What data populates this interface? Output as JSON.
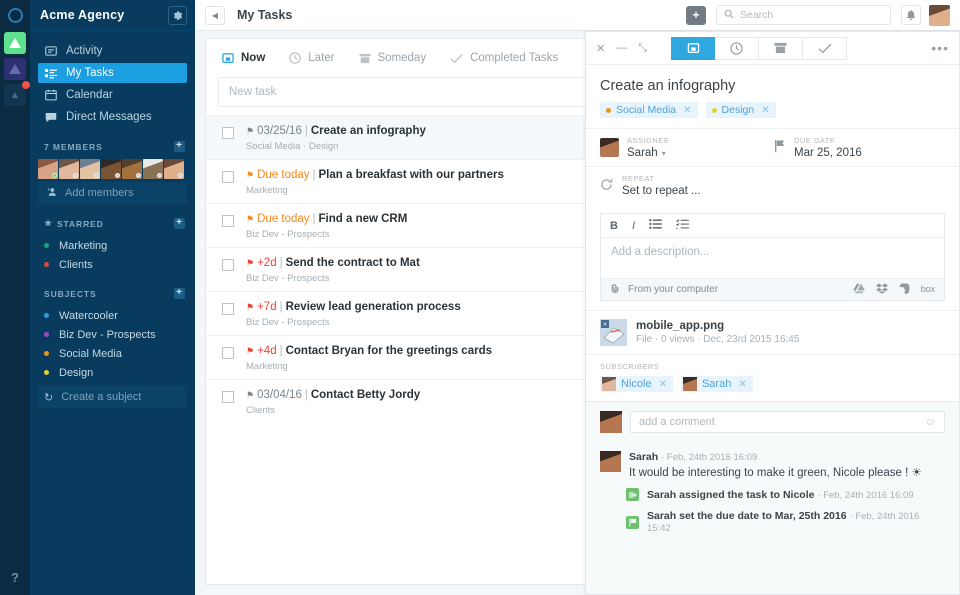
{
  "rail": {
    "logo_icon": "circle-logo-icon",
    "items": [
      {
        "name": "workspace-green",
        "icon": "triangle-icon",
        "badge": false
      },
      {
        "name": "workspace-purple",
        "icon": "triangle-icon",
        "badge": false
      },
      {
        "name": "workspace-more",
        "icon": "triangles-icon",
        "badge": true
      }
    ],
    "help_label": "?"
  },
  "sidebar": {
    "title": "Acme Agency",
    "gear_icon": "gear-icon",
    "nav": [
      {
        "label": "Activity",
        "icon": "activity-icon",
        "active": false
      },
      {
        "label": "My Tasks",
        "icon": "tasks-icon",
        "active": true
      },
      {
        "label": "Calendar",
        "icon": "calendar-icon",
        "active": false
      },
      {
        "label": "Direct Messages",
        "icon": "message-icon",
        "active": false
      }
    ],
    "members": {
      "header": "7 MEMBERS",
      "add_label": "Add members",
      "add_icon": "add-person-icon",
      "avatars": [
        {
          "name": "member-1",
          "c1": "#8a5a44",
          "c2": "#d8a384",
          "presence": "#6dd36d"
        },
        {
          "name": "member-2",
          "c1": "#6d5547",
          "c2": "#e2b89c",
          "presence": "#c9cfd3"
        },
        {
          "name": "member-3",
          "c1": "#6f7f92",
          "c2": "#e3c3a4",
          "presence": "#c9cfd3"
        },
        {
          "name": "member-4",
          "c1": "#2e2a28",
          "c2": "#7b5436",
          "presence": "#c9cfd3"
        },
        {
          "name": "member-5",
          "c1": "#52402f",
          "c2": "#a3713f",
          "presence": "#c9cfd3"
        },
        {
          "name": "member-6",
          "c1": "#e9e9e9",
          "c2": "#8a7256",
          "presence": "#c9cfd3"
        },
        {
          "name": "member-7",
          "c1": "#6b4a38",
          "c2": "#e0b08c",
          "presence": "#c9cfd3"
        }
      ]
    },
    "starred": {
      "header": "STARRED",
      "items": [
        {
          "label": "Marketing",
          "color": "#18a47c"
        },
        {
          "label": "Clients",
          "color": "#e0473c"
        }
      ]
    },
    "subjects": {
      "header": "SUBJECTS",
      "items": [
        {
          "label": "Watercooler",
          "color": "#2b9fe3"
        },
        {
          "label": "Biz Dev - Prospects",
          "color": "#a546c9"
        },
        {
          "label": "Social Media",
          "color": "#e89519"
        },
        {
          "label": "Design",
          "color": "#e2d12f"
        }
      ],
      "create_label": "Create a subject",
      "create_icon": "refresh-icon"
    }
  },
  "topbar": {
    "back_icon": "chevron-left-icon",
    "title": "My Tasks",
    "plus_icon": "plus-icon",
    "search": {
      "placeholder": "Search",
      "icon": "search-icon",
      "value": ""
    },
    "bell_icon": "bell-icon",
    "avatar": {
      "name": "current-user-avatar",
      "c1": "#6b4a38",
      "c2": "#e0b08c"
    }
  },
  "tasklist": {
    "tabs": [
      {
        "label": "Now",
        "icon": "inbox-icon",
        "active": true
      },
      {
        "label": "Later",
        "icon": "clock-icon",
        "active": false
      },
      {
        "label": "Someday",
        "icon": "archive-icon",
        "active": false
      },
      {
        "label": "Completed Tasks",
        "icon": "check-icon",
        "active": false
      }
    ],
    "new_task_placeholder": "New task",
    "rows": [
      {
        "due": "03/25/16",
        "due_style": "gray",
        "title": "Create an infography",
        "subject": "Social Media · Design",
        "selected": true
      },
      {
        "due": "Due today",
        "due_style": "orange",
        "title": "Plan a breakfast with our partners",
        "subject": "Marketing",
        "selected": false
      },
      {
        "due": "Due today",
        "due_style": "orange",
        "title": "Find a new CRM",
        "subject": "Biz Dev - Prospects",
        "selected": false
      },
      {
        "due": "+2d",
        "due_style": "red",
        "title": "Send the contract to Mat",
        "subject": "Biz Dev - Prospects",
        "selected": false
      },
      {
        "due": "+7d",
        "due_style": "red",
        "title": "Review lead generation process",
        "subject": "Biz Dev - Prospects",
        "selected": false
      },
      {
        "due": "+4d",
        "due_style": "red",
        "title": "Contact Bryan for the greetings cards",
        "subject": "Marketing",
        "selected": false
      },
      {
        "due": "03/04/16",
        "due_style": "gray",
        "title": "Contact Betty Jordy",
        "subject": "Clients",
        "selected": false
      }
    ]
  },
  "detail": {
    "window_controls": [
      {
        "name": "close-icon",
        "glyph": "✕"
      },
      {
        "name": "minimize-icon",
        "glyph": "—"
      },
      {
        "name": "expand-icon",
        "glyph": "⤡"
      }
    ],
    "modes": [
      {
        "name": "now-mode",
        "icon": "inbox-icon",
        "active": true
      },
      {
        "name": "later-mode",
        "icon": "clock-icon",
        "active": false
      },
      {
        "name": "someday-mode",
        "icon": "archive-icon",
        "active": false
      },
      {
        "name": "complete-mode",
        "icon": "check-icon",
        "active": false
      }
    ],
    "more_icon": "more-horizontal-icon",
    "title": "Create an infography",
    "tags": [
      {
        "label": "Social Media",
        "color": "#e89519"
      },
      {
        "label": "Design",
        "color": "#e2d12f"
      }
    ],
    "assignee": {
      "label": "ASSIGNEE",
      "value": "Sarah"
    },
    "due_date": {
      "label": "DUE DATE",
      "value": "Mar 25, 2016",
      "icon": "flag-icon"
    },
    "repeat": {
      "label": "REPEAT",
      "value": "Set to repeat ...",
      "icon": "repeat-icon"
    },
    "editor": {
      "tools": [
        {
          "name": "bold-icon",
          "glyph": "B"
        },
        {
          "name": "italic-icon",
          "glyph": "I"
        },
        {
          "name": "bullet-list-icon",
          "glyph": "☰"
        },
        {
          "name": "checklist-icon",
          "glyph": "≣"
        }
      ],
      "placeholder": "Add a description...",
      "upload_label": "From your computer",
      "upload_icon": "paperclip-icon",
      "services": [
        {
          "name": "google-drive-icon",
          "color": "#8e99a1"
        },
        {
          "name": "dropbox-icon",
          "color": "#8e99a1"
        },
        {
          "name": "evernote-icon",
          "color": "#8e99a1"
        },
        {
          "name": "box-icon",
          "label": "box"
        }
      ]
    },
    "attachment": {
      "name": "mobile_app.png",
      "meta": "File · 0 views · Dec, 23rd 2015 16:45"
    },
    "subscribers": {
      "label": "SUBSCRIBERS",
      "items": [
        {
          "name": "Nicole",
          "c1": "#6d5547",
          "c2": "#e2b89c"
        },
        {
          "name": "Sarah",
          "c1": "#3a2a22",
          "c2": "#b5774f"
        }
      ]
    },
    "comment": {
      "placeholder": "add a comment",
      "smiley_icon": "smiley-icon"
    },
    "feed": [
      {
        "type": "comment",
        "author": "Sarah",
        "time": "Feb, 24th 2016 16:09",
        "text": "It would be interesting to make it green, Nicole please ! ☀"
      },
      {
        "type": "event",
        "icon": "assign-icon",
        "icon_color": "#6ec06e",
        "text": "Sarah assigned the task to Nicole",
        "time": "Feb, 24th 2016 16:09"
      },
      {
        "type": "event",
        "icon": "flag-event-icon",
        "icon_color": "#6ec06e",
        "text": "Sarah set the due date to Mar, 25th 2016",
        "time": "Feb, 24th 2016 15:42"
      }
    ]
  }
}
